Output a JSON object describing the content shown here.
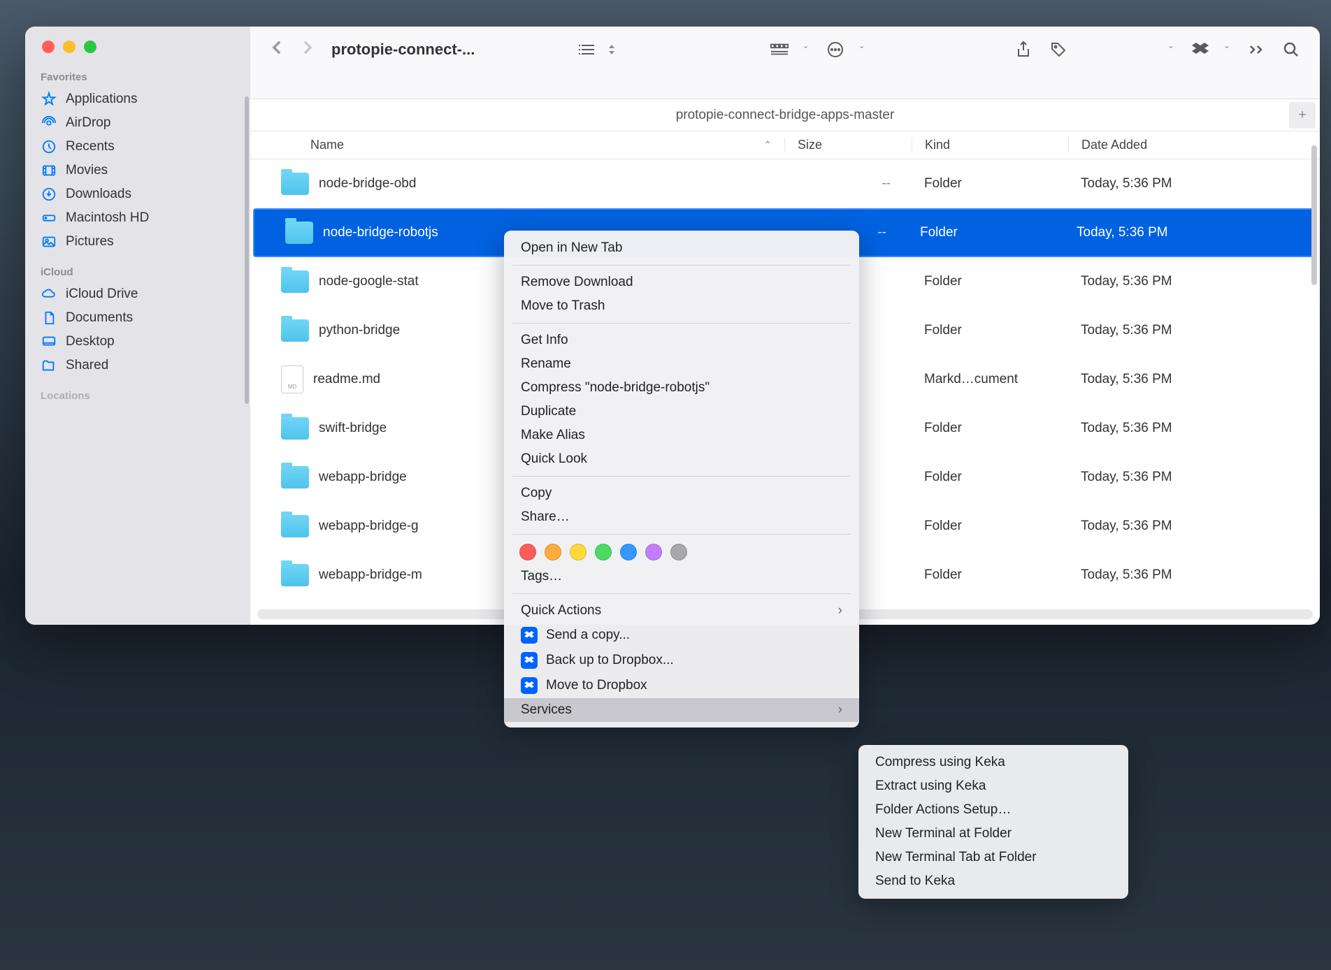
{
  "window": {
    "title": "protopie-connect-...",
    "sidebar": {
      "favorites_label": "Favorites",
      "icloud_label": "iCloud",
      "locations_label": "Locations",
      "items": [
        {
          "label": "Applications"
        },
        {
          "label": "AirDrop"
        },
        {
          "label": "Recents"
        },
        {
          "label": "Movies"
        },
        {
          "label": "Downloads"
        },
        {
          "label": "Macintosh HD"
        },
        {
          "label": "Pictures"
        }
      ],
      "icloud_items": [
        {
          "label": "iCloud Drive"
        },
        {
          "label": "Documents"
        },
        {
          "label": "Desktop"
        },
        {
          "label": "Shared"
        }
      ]
    },
    "path_bar": "protopie-connect-bridge-apps-master",
    "columns": {
      "name": "Name",
      "size": "Size",
      "kind": "Kind",
      "date": "Date Added"
    },
    "rows": [
      {
        "name": "node-bridge-obd",
        "size": "--",
        "kind": "Folder",
        "date": "Today, 5:36 PM",
        "type": "folder",
        "selected": false
      },
      {
        "name": "node-bridge-robotjs",
        "size": "--",
        "kind": "Folder",
        "date": "Today, 5:36 PM",
        "type": "folder",
        "selected": true
      },
      {
        "name": "node-google-stat",
        "size": "",
        "kind": "Folder",
        "date": "Today, 5:36 PM",
        "type": "folder",
        "selected": false
      },
      {
        "name": "python-bridge",
        "size": "",
        "kind": "Folder",
        "date": "Today, 5:36 PM",
        "type": "folder",
        "selected": false
      },
      {
        "name": "readme.md",
        "size": "",
        "kind": "Markd…cument",
        "date": "Today, 5:36 PM",
        "type": "file",
        "selected": false
      },
      {
        "name": "swift-bridge",
        "size": "",
        "kind": "Folder",
        "date": "Today, 5:36 PM",
        "type": "folder",
        "selected": false
      },
      {
        "name": "webapp-bridge",
        "size": "",
        "kind": "Folder",
        "date": "Today, 5:36 PM",
        "type": "folder",
        "selected": false
      },
      {
        "name": "webapp-bridge-g",
        "size": "",
        "kind": "Folder",
        "date": "Today, 5:36 PM",
        "type": "folder",
        "selected": false
      },
      {
        "name": "webapp-bridge-m",
        "size": "",
        "kind": "Folder",
        "date": "Today, 5:36 PM",
        "type": "folder",
        "selected": false
      }
    ]
  },
  "context_menu": {
    "items": [
      {
        "label": "Open in New Tab"
      },
      {
        "sep": true
      },
      {
        "label": "Remove Download"
      },
      {
        "label": "Move to Trash"
      },
      {
        "sep": true
      },
      {
        "label": "Get Info"
      },
      {
        "label": "Rename"
      },
      {
        "label": "Compress \"node-bridge-robotjs\""
      },
      {
        "label": "Duplicate"
      },
      {
        "label": "Make Alias"
      },
      {
        "label": "Quick Look"
      },
      {
        "sep": true
      },
      {
        "label": "Copy"
      },
      {
        "label": "Share…"
      },
      {
        "sep": true
      },
      {
        "tags": true,
        "colors": [
          "#ff5c5c",
          "#ffac3e",
          "#ffd93b",
          "#4cd964",
          "#3498ff",
          "#c17dff",
          "#a8a8ac"
        ]
      },
      {
        "label": "Tags…"
      },
      {
        "sep": true
      },
      {
        "label": "Quick Actions",
        "submenu": true
      },
      {
        "label": "Send a copy...",
        "dropbox": true
      },
      {
        "label": "Back up to Dropbox...",
        "dropbox": true
      },
      {
        "label": "Move to Dropbox",
        "dropbox": true
      },
      {
        "label": "Services",
        "submenu": true,
        "highlighted": true
      }
    ]
  },
  "services_submenu": {
    "items": [
      {
        "label": "Compress using Keka"
      },
      {
        "label": "Extract using Keka"
      },
      {
        "label": "Folder Actions Setup…"
      },
      {
        "label": "New Terminal at Folder"
      },
      {
        "label": "New Terminal Tab at Folder"
      },
      {
        "label": "Send to Keka"
      }
    ]
  }
}
